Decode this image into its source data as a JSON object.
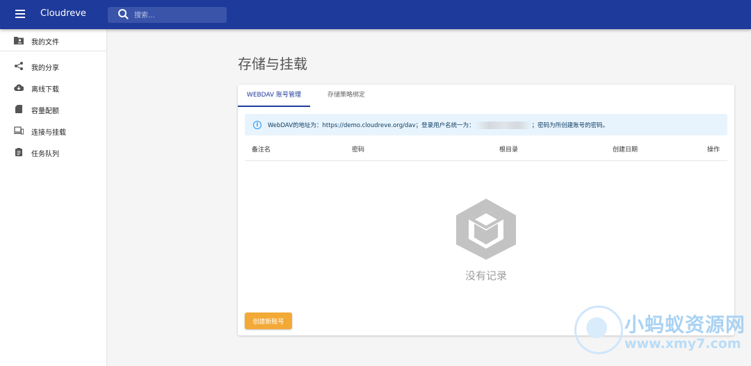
{
  "appbar": {
    "title": "Cloudreve",
    "search_placeholder": "搜索..."
  },
  "sidebar": {
    "items": [
      {
        "label": "我的文件",
        "icon": "folder-account-icon"
      },
      {
        "label": "我的分享",
        "icon": "share-icon"
      },
      {
        "label": "离线下载",
        "icon": "cloud-download-icon"
      },
      {
        "label": "容量配额",
        "icon": "sd-card-icon"
      },
      {
        "label": "连接与挂载",
        "icon": "devices-icon"
      },
      {
        "label": "任务队列",
        "icon": "clipboard-list-icon"
      }
    ]
  },
  "page": {
    "title": "存储与挂载"
  },
  "tabs": [
    {
      "label": "WEBDAV 账号管理",
      "active": true
    },
    {
      "label": "存储策略绑定",
      "active": false
    }
  ],
  "info": {
    "prefix": "WebDAV的地址为：https://demo.cloudreve.org/dav；登录用户名统一为：",
    "suffix": "；密码为所创建账号的密码。"
  },
  "table": {
    "headers": [
      "备注名",
      "密码",
      "根目录",
      "创建日期",
      "操作"
    ]
  },
  "empty": {
    "text": "没有记录"
  },
  "actions": {
    "create_label": "创建新账号"
  },
  "watermark": {
    "title": "小蚂蚁资源网",
    "url": "www.xmy7.com"
  },
  "colors": {
    "appbar": "#1e3a9a",
    "accent_button": "#f3a935",
    "info_background": "#e8f4fd"
  }
}
